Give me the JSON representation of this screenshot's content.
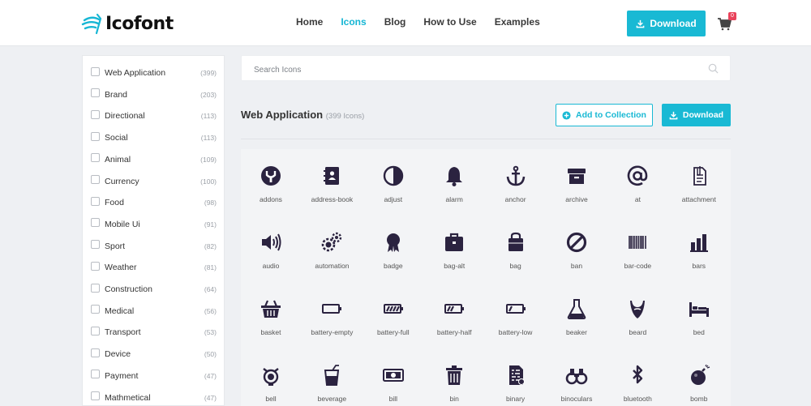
{
  "brand": {
    "logo_text": "Icofont"
  },
  "nav": {
    "items": [
      {
        "label": "Home",
        "active": false
      },
      {
        "label": "Icons",
        "active": true
      },
      {
        "label": "Blog",
        "active": false
      },
      {
        "label": "How to Use",
        "active": false
      },
      {
        "label": "Examples",
        "active": false
      }
    ],
    "download_label": "Download",
    "cart_count": "0"
  },
  "sidebar": {
    "categories": [
      {
        "label": "Web Application",
        "count": "(399)"
      },
      {
        "label": "Brand",
        "count": "(203)"
      },
      {
        "label": "Directional",
        "count": "(113)"
      },
      {
        "label": "Social",
        "count": "(113)"
      },
      {
        "label": "Animal",
        "count": "(109)"
      },
      {
        "label": "Currency",
        "count": "(100)"
      },
      {
        "label": "Food",
        "count": "(98)"
      },
      {
        "label": "Mobile Ui",
        "count": "(91)"
      },
      {
        "label": "Sport",
        "count": "(82)"
      },
      {
        "label": "Weather",
        "count": "(81)"
      },
      {
        "label": "Construction",
        "count": "(64)"
      },
      {
        "label": "Medical",
        "count": "(56)"
      },
      {
        "label": "Transport",
        "count": "(53)"
      },
      {
        "label": "Device",
        "count": "(50)"
      },
      {
        "label": "Payment",
        "count": "(47)"
      },
      {
        "label": "Mathmetical",
        "count": "(47)"
      }
    ]
  },
  "search": {
    "placeholder": "Search Icons",
    "value": ""
  },
  "section": {
    "title": "Web Application",
    "count": "(399 Icons)",
    "add_collection_label": "Add to Collection",
    "download_label": "Download"
  },
  "icons": [
    "addons",
    "address-book",
    "adjust",
    "alarm",
    "anchor",
    "archive",
    "at",
    "attachment",
    "audio",
    "automation",
    "badge",
    "bag-alt",
    "bag",
    "ban",
    "bar-code",
    "bars",
    "basket",
    "battery-empty",
    "battery-full",
    "battery-half",
    "battery-low",
    "beaker",
    "beard",
    "bed",
    "bell",
    "beverage",
    "bill",
    "bin",
    "binary",
    "binoculars",
    "bluetooth",
    "bomb"
  ],
  "colors": {
    "accent": "#19b9d4",
    "icon": "#2b2340",
    "badge": "#e9435b"
  }
}
